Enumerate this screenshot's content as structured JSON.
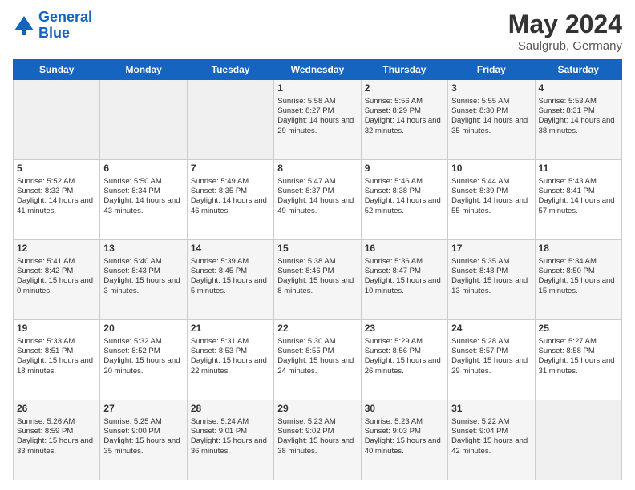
{
  "header": {
    "logo_line1": "General",
    "logo_line2": "Blue",
    "month_year": "May 2024",
    "location": "Saulgrub, Germany"
  },
  "days_of_week": [
    "Sunday",
    "Monday",
    "Tuesday",
    "Wednesday",
    "Thursday",
    "Friday",
    "Saturday"
  ],
  "weeks": [
    [
      {
        "day": "",
        "sunrise": "",
        "sunset": "",
        "daylight": "",
        "empty": true
      },
      {
        "day": "",
        "sunrise": "",
        "sunset": "",
        "daylight": "",
        "empty": true
      },
      {
        "day": "",
        "sunrise": "",
        "sunset": "",
        "daylight": "",
        "empty": true
      },
      {
        "day": "1",
        "sunrise": "Sunrise: 5:58 AM",
        "sunset": "Sunset: 8:27 PM",
        "daylight": "Daylight: 14 hours and 29 minutes."
      },
      {
        "day": "2",
        "sunrise": "Sunrise: 5:56 AM",
        "sunset": "Sunset: 8:29 PM",
        "daylight": "Daylight: 14 hours and 32 minutes."
      },
      {
        "day": "3",
        "sunrise": "Sunrise: 5:55 AM",
        "sunset": "Sunset: 8:30 PM",
        "daylight": "Daylight: 14 hours and 35 minutes."
      },
      {
        "day": "4",
        "sunrise": "Sunrise: 5:53 AM",
        "sunset": "Sunset: 8:31 PM",
        "daylight": "Daylight: 14 hours and 38 minutes."
      }
    ],
    [
      {
        "day": "5",
        "sunrise": "Sunrise: 5:52 AM",
        "sunset": "Sunset: 8:33 PM",
        "daylight": "Daylight: 14 hours and 41 minutes."
      },
      {
        "day": "6",
        "sunrise": "Sunrise: 5:50 AM",
        "sunset": "Sunset: 8:34 PM",
        "daylight": "Daylight: 14 hours and 43 minutes."
      },
      {
        "day": "7",
        "sunrise": "Sunrise: 5:49 AM",
        "sunset": "Sunset: 8:35 PM",
        "daylight": "Daylight: 14 hours and 46 minutes."
      },
      {
        "day": "8",
        "sunrise": "Sunrise: 5:47 AM",
        "sunset": "Sunset: 8:37 PM",
        "daylight": "Daylight: 14 hours and 49 minutes."
      },
      {
        "day": "9",
        "sunrise": "Sunrise: 5:46 AM",
        "sunset": "Sunset: 8:38 PM",
        "daylight": "Daylight: 14 hours and 52 minutes."
      },
      {
        "day": "10",
        "sunrise": "Sunrise: 5:44 AM",
        "sunset": "Sunset: 8:39 PM",
        "daylight": "Daylight: 14 hours and 55 minutes."
      },
      {
        "day": "11",
        "sunrise": "Sunrise: 5:43 AM",
        "sunset": "Sunset: 8:41 PM",
        "daylight": "Daylight: 14 hours and 57 minutes."
      }
    ],
    [
      {
        "day": "12",
        "sunrise": "Sunrise: 5:41 AM",
        "sunset": "Sunset: 8:42 PM",
        "daylight": "Daylight: 15 hours and 0 minutes."
      },
      {
        "day": "13",
        "sunrise": "Sunrise: 5:40 AM",
        "sunset": "Sunset: 8:43 PM",
        "daylight": "Daylight: 15 hours and 3 minutes."
      },
      {
        "day": "14",
        "sunrise": "Sunrise: 5:39 AM",
        "sunset": "Sunset: 8:45 PM",
        "daylight": "Daylight: 15 hours and 5 minutes."
      },
      {
        "day": "15",
        "sunrise": "Sunrise: 5:38 AM",
        "sunset": "Sunset: 8:46 PM",
        "daylight": "Daylight: 15 hours and 8 minutes."
      },
      {
        "day": "16",
        "sunrise": "Sunrise: 5:36 AM",
        "sunset": "Sunset: 8:47 PM",
        "daylight": "Daylight: 15 hours and 10 minutes."
      },
      {
        "day": "17",
        "sunrise": "Sunrise: 5:35 AM",
        "sunset": "Sunset: 8:48 PM",
        "daylight": "Daylight: 15 hours and 13 minutes."
      },
      {
        "day": "18",
        "sunrise": "Sunrise: 5:34 AM",
        "sunset": "Sunset: 8:50 PM",
        "daylight": "Daylight: 15 hours and 15 minutes."
      }
    ],
    [
      {
        "day": "19",
        "sunrise": "Sunrise: 5:33 AM",
        "sunset": "Sunset: 8:51 PM",
        "daylight": "Daylight: 15 hours and 18 minutes."
      },
      {
        "day": "20",
        "sunrise": "Sunrise: 5:32 AM",
        "sunset": "Sunset: 8:52 PM",
        "daylight": "Daylight: 15 hours and 20 minutes."
      },
      {
        "day": "21",
        "sunrise": "Sunrise: 5:31 AM",
        "sunset": "Sunset: 8:53 PM",
        "daylight": "Daylight: 15 hours and 22 minutes."
      },
      {
        "day": "22",
        "sunrise": "Sunrise: 5:30 AM",
        "sunset": "Sunset: 8:55 PM",
        "daylight": "Daylight: 15 hours and 24 minutes."
      },
      {
        "day": "23",
        "sunrise": "Sunrise: 5:29 AM",
        "sunset": "Sunset: 8:56 PM",
        "daylight": "Daylight: 15 hours and 26 minutes."
      },
      {
        "day": "24",
        "sunrise": "Sunrise: 5:28 AM",
        "sunset": "Sunset: 8:57 PM",
        "daylight": "Daylight: 15 hours and 29 minutes."
      },
      {
        "day": "25",
        "sunrise": "Sunrise: 5:27 AM",
        "sunset": "Sunset: 8:58 PM",
        "daylight": "Daylight: 15 hours and 31 minutes."
      }
    ],
    [
      {
        "day": "26",
        "sunrise": "Sunrise: 5:26 AM",
        "sunset": "Sunset: 8:59 PM",
        "daylight": "Daylight: 15 hours and 33 minutes."
      },
      {
        "day": "27",
        "sunrise": "Sunrise: 5:25 AM",
        "sunset": "Sunset: 9:00 PM",
        "daylight": "Daylight: 15 hours and 35 minutes."
      },
      {
        "day": "28",
        "sunrise": "Sunrise: 5:24 AM",
        "sunset": "Sunset: 9:01 PM",
        "daylight": "Daylight: 15 hours and 36 minutes."
      },
      {
        "day": "29",
        "sunrise": "Sunrise: 5:23 AM",
        "sunset": "Sunset: 9:02 PM",
        "daylight": "Daylight: 15 hours and 38 minutes."
      },
      {
        "day": "30",
        "sunrise": "Sunrise: 5:23 AM",
        "sunset": "Sunset: 9:03 PM",
        "daylight": "Daylight: 15 hours and 40 minutes."
      },
      {
        "day": "31",
        "sunrise": "Sunrise: 5:22 AM",
        "sunset": "Sunset: 9:04 PM",
        "daylight": "Daylight: 15 hours and 42 minutes."
      },
      {
        "day": "",
        "sunrise": "",
        "sunset": "",
        "daylight": "",
        "empty": true
      }
    ]
  ]
}
